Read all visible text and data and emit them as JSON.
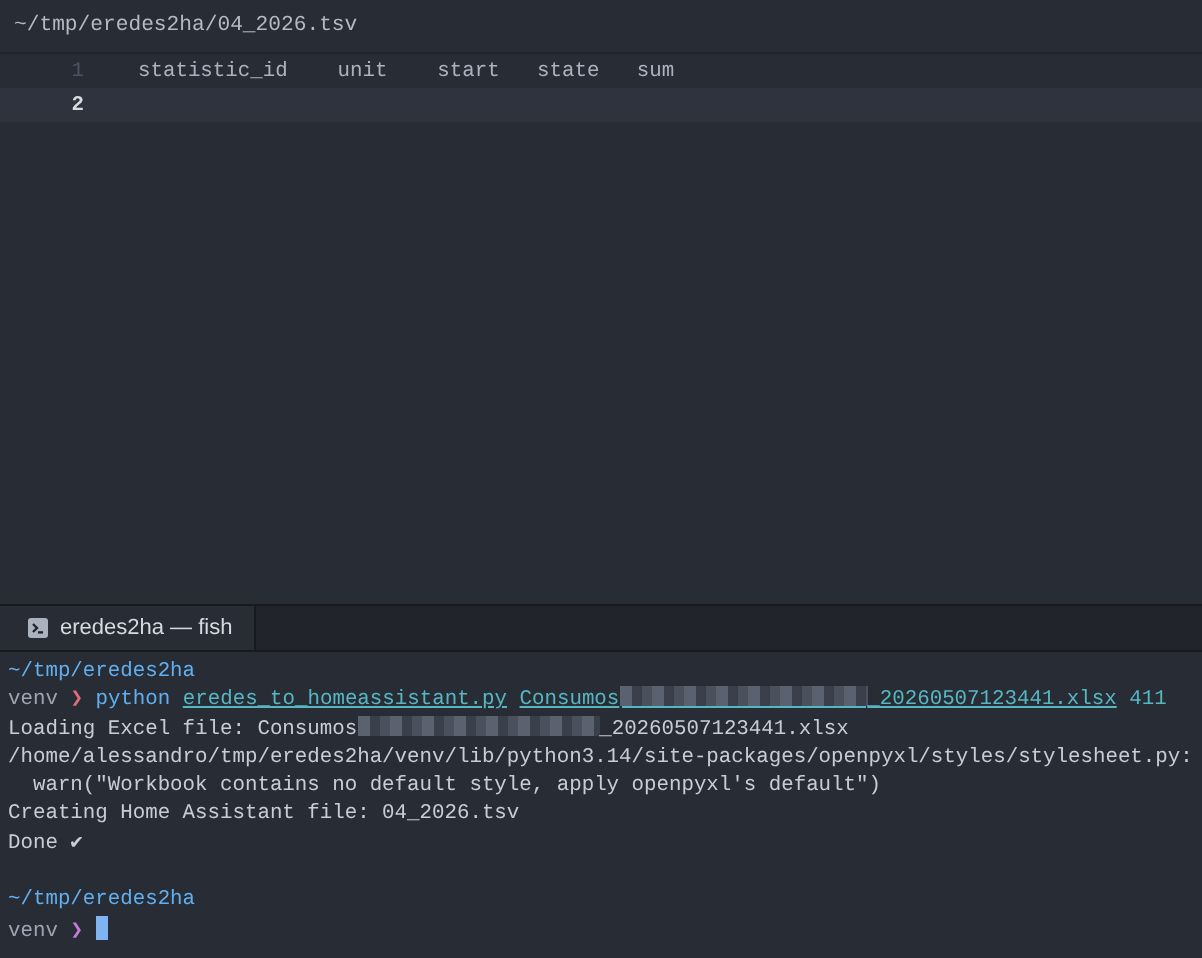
{
  "editor": {
    "file_path": "~/tmp/eredes2ha/04_2026.tsv",
    "lines": [
      {
        "number": "1",
        "current": false,
        "cells": [
          "statistic_id",
          "unit",
          "start",
          "state",
          "sum"
        ]
      },
      {
        "number": "2",
        "current": true
      }
    ]
  },
  "terminal": {
    "tabs": [
      {
        "label": "eredes2ha — fish",
        "selected": true
      }
    ],
    "lines": [
      [
        {
          "kind": "path",
          "text": "~/tmp/eredes2ha"
        }
      ],
      [
        {
          "kind": "env",
          "text": "venv"
        },
        {
          "kind": "chevron",
          "text": "❯",
          "color": "#e06c75"
        },
        {
          "kind": "command",
          "text": "python"
        },
        {
          "kind": "arg",
          "text": "eredes_to_homeassistant.py"
        },
        {
          "kind": "arg",
          "text": "Consumos"
        },
        {
          "kind": "redacted",
          "underline": true
        },
        {
          "kind": "arg",
          "text": "_20260507123441.xlsx"
        },
        {
          "kind": "number",
          "text": "411"
        }
      ],
      [
        {
          "kind": "plain",
          "text": "Loading Excel file: Consumos"
        },
        {
          "kind": "redacted",
          "underline": false
        },
        {
          "kind": "plain",
          "text": "_20260507123441.xlsx"
        }
      ],
      [
        {
          "kind": "plain",
          "text": "/home/alessandro/tmp/eredes2ha/venv/lib/python3.14/site-packages/openpyxl/styles/stylesheet.py:"
        }
      ],
      [
        {
          "kind": "plain",
          "text": "  warn(\"Workbook contains no default style, apply openpyxl's default\")"
        }
      ],
      [
        {
          "kind": "plain",
          "text": "Creating Home Assistant file: 04_2026.tsv"
        }
      ],
      [
        {
          "kind": "plain",
          "text": "Done ✔"
        }
      ],
      [
        {
          "kind": "gap"
        },
        {
          "kind": "path",
          "text": "~/tmp/eredes2ha"
        }
      ],
      [
        {
          "kind": "env",
          "text": "venv"
        },
        {
          "kind": "chevron",
          "text": "❯",
          "color": "#c678dd"
        },
        {
          "kind": "cursor"
        }
      ]
    ]
  }
}
